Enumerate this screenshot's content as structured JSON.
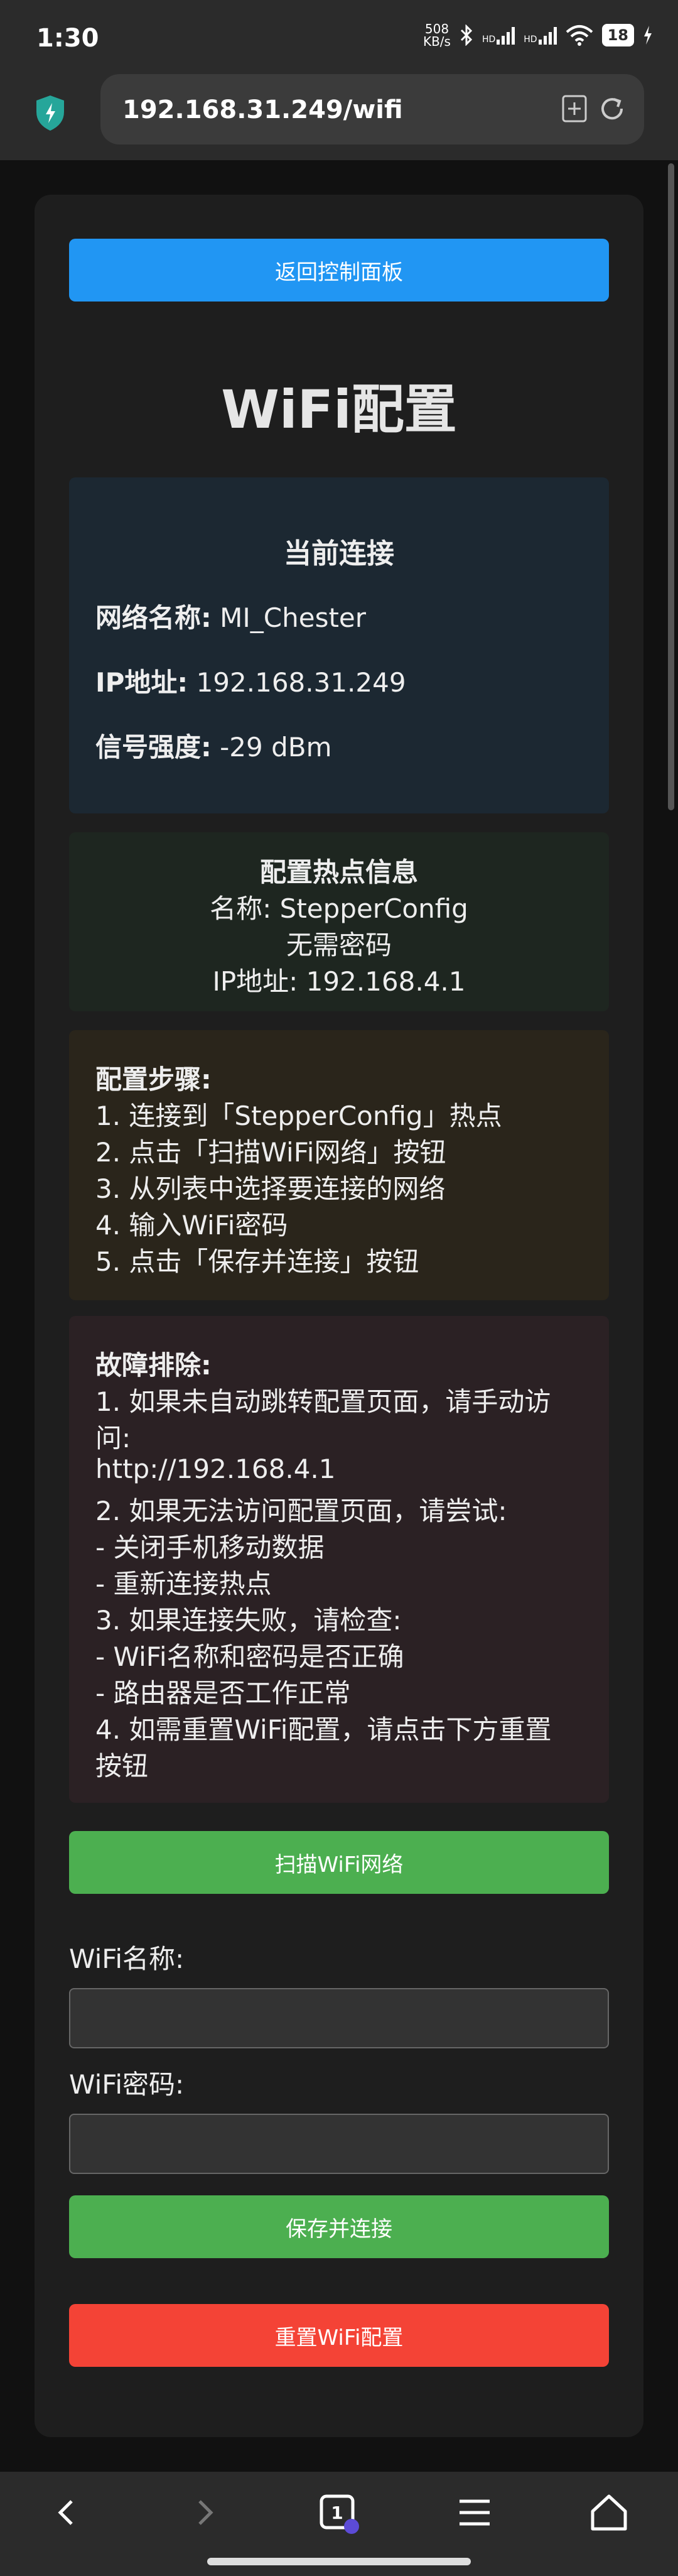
{
  "status_bar": {
    "time": "1:30",
    "net_speed_value": "508",
    "net_speed_unit": "KB/s",
    "hd1": "HD",
    "hd2": "HD",
    "battery": "18",
    "icons": [
      "bluetooth-icon",
      "signal-icon",
      "signal-icon",
      "wifi-icon",
      "battery-icon",
      "charging-icon"
    ]
  },
  "browser": {
    "url": "192.168.31.249/wifi",
    "icons": [
      "shield-icon",
      "bookmark-add-icon",
      "reload-icon"
    ]
  },
  "page": {
    "back_button": "返回控制面板",
    "title": "WiFi配置",
    "current": {
      "heading": "当前连接",
      "ssid_label": "网络名称:",
      "ssid_value": "MI_Chester",
      "ip_label": "IP地址:",
      "ip_value": "192.168.31.249",
      "rssi_label": "信号强度:",
      "rssi_value": "-29 dBm"
    },
    "ap": {
      "heading": "配置热点信息",
      "name": "名称: StepperConfig",
      "password": "无需密码",
      "ip": "IP地址: 192.168.4.1"
    },
    "steps": {
      "heading": "配置步骤:",
      "lines": [
        "1. 连接到「StepperConfig」热点",
        "2. 点击「扫描WiFi网络」按钮",
        "3. 从列表中选择要连接的网络",
        "4. 输入WiFi密码",
        "5. 点击「保存并连接」按钮"
      ]
    },
    "trouble": {
      "heading": "故障排除:",
      "lines": [
        "1. 如果未自动跳转配置页面，请手动访",
        "问:",
        "http://192.168.4.1",
        "2. 如果无法访问配置页面，请尝试:",
        "- 关闭手机移动数据",
        "- 重新连接热点",
        "3. 如果连接失败，请检查:",
        "- WiFi名称和密码是否正确",
        "- 路由器是否工作正常",
        "4. 如需重置WiFi配置，请点击下方重置",
        "按钮"
      ]
    },
    "scan_button": "扫描WiFi网络",
    "ssid_field_label": "WiFi名称:",
    "ssid_field_value": "",
    "password_field_label": "WiFi密码:",
    "password_field_value": "",
    "save_button": "保存并连接",
    "reset_button": "重置WiFi配置"
  },
  "nav": {
    "tab_count": "1",
    "icons": [
      "back-icon",
      "forward-icon",
      "tabs-icon",
      "menu-icon",
      "home-icon"
    ]
  },
  "colors": {
    "blue": "#2196f3",
    "green": "#4caf50",
    "red": "#f44336"
  }
}
